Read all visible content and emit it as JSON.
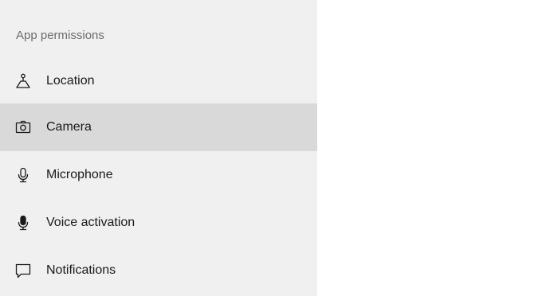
{
  "sidebar": {
    "section_header": "App permissions",
    "items": [
      {
        "label": "Location",
        "icon": "location-icon",
        "selected": false
      },
      {
        "label": "Camera",
        "icon": "camera-icon",
        "selected": true
      },
      {
        "label": "Microphone",
        "icon": "microphone-icon",
        "selected": false
      },
      {
        "label": "Voice activation",
        "icon": "voice-activation-icon",
        "selected": false
      },
      {
        "label": "Notifications",
        "icon": "notifications-icon",
        "selected": false
      }
    ]
  },
  "colors": {
    "sidebar_background": "#f0f0f0",
    "selected_background": "#d9d9d9",
    "header_text": "#6b6b6b",
    "item_text": "#1a1a1a",
    "content_background": "#ffffff"
  }
}
